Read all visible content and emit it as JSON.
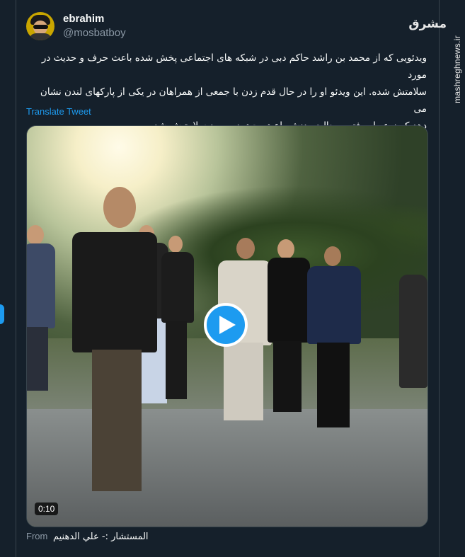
{
  "author": {
    "display_name": "ebrahim",
    "handle": "@mosbatboy"
  },
  "watermark": {
    "logo_text": "مشرق",
    "site": "mashreghnews.ir"
  },
  "tweet": {
    "text_line1": "ویدئویی که از محمد بن راشد حاکم دبی در شبکه های اجتماعی پخش شده باعث حرف و حدیث در مورد",
    "text_line2": "سلامتش شده. این ویدئو او را در حال قدم زدن با جمعی از همراهان در یکی از پارکهای لندن نشان می",
    "text_line3": "دهد که نوع راه رفتن و حالت بدنش باعث بحث در مورد سلامتیش شده",
    "translate_label": "Translate Tweet"
  },
  "video": {
    "duration": "0:10",
    "play_icon": "play-icon"
  },
  "source": {
    "from_label": "From",
    "name": "المستشار :- علي الدهنيم"
  },
  "colors": {
    "background": "#15202b",
    "accent": "#1d9bf0",
    "secondary_text": "#8b98a5"
  }
}
